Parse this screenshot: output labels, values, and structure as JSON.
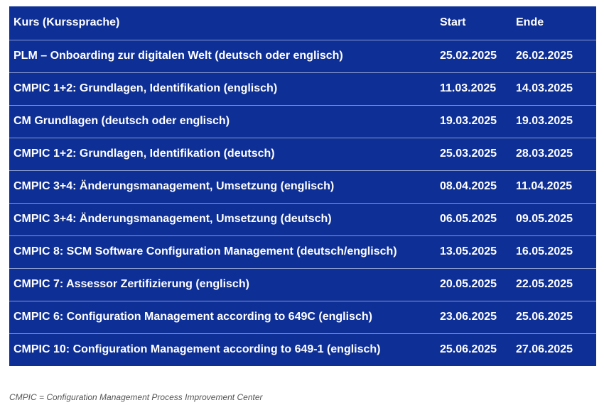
{
  "table": {
    "headers": {
      "course": "Kurs (Kurssprache)",
      "start": "Start",
      "end": "Ende"
    },
    "rows": [
      {
        "course": "PLM – Onboarding zur digitalen Welt (deutsch oder englisch)",
        "start": "25.02.2025",
        "end": "26.02.2025"
      },
      {
        "course": "CMPIC 1+2: Grundlagen, Identifikation (englisch)",
        "start": "11.03.2025",
        "end": "14.03.2025"
      },
      {
        "course": "CM Grundlagen (deutsch oder englisch)",
        "start": "19.03.2025",
        "end": "19.03.2025"
      },
      {
        "course": "CMPIC 1+2: Grundlagen, Identifikation (deutsch)",
        "start": "25.03.2025",
        "end": "28.03.2025"
      },
      {
        "course": "CMPIC 3+4: Änderungsmanagement, Umsetzung (englisch)",
        "start": "08.04.2025",
        "end": "11.04.2025"
      },
      {
        "course": "CMPIC 3+4: Änderungsmanagement, Umsetzung (deutsch)",
        "start": "06.05.2025",
        "end": "09.05.2025"
      },
      {
        "course": "CMPIC 8: SCM Software Configuration Management (deutsch/englisch)",
        "start": "13.05.2025",
        "end": "16.05.2025"
      },
      {
        "course": "CMPIC 7: Assessor Zertifizierung (englisch)",
        "start": "20.05.2025",
        "end": "22.05.2025"
      },
      {
        "course": "CMPIC 6: Configuration Management according to 649C (englisch)",
        "start": "23.06.2025",
        "end": "25.06.2025"
      },
      {
        "course": "CMPIC 10: Configuration Management according to 649-1 (englisch)",
        "start": "25.06.2025",
        "end": "27.06.2025"
      }
    ]
  },
  "footnote": "CMPIC = Configuration Management Process Improvement Center",
  "colors": {
    "table_background": "#0e2f96",
    "table_text": "#ffffff",
    "row_divider": "#8c9ccf"
  }
}
